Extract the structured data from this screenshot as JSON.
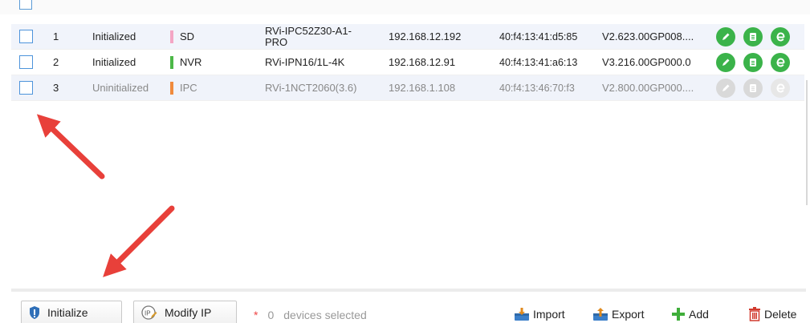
{
  "table": {
    "rows": [
      {
        "no": "1",
        "status": "Initialized",
        "type": "SD",
        "type_color": "#f4a6c4",
        "model_line1": "RVi-IPC52Z30-A1-",
        "model_line2": "PRO",
        "ip": "192.168.12.192",
        "mac": "40:f4:13:41:d5:85",
        "version": "V2.623.00GP008....",
        "enabled": true
      },
      {
        "no": "2",
        "status": "Initialized",
        "type": "NVR",
        "type_color": "#4cb848",
        "model_line1": "RVi-IPN16/1L-4K",
        "model_line2": "",
        "ip": "192.168.12.91",
        "mac": "40:f4:13:41:a6:13",
        "version": "V3.216.00GP000.0",
        "enabled": true
      },
      {
        "no": "3",
        "status": "Uninitialized",
        "type": "IPC",
        "type_color": "#f08a3c",
        "model_line1": "RVi-1NCT2060(3.6)",
        "model_line2": "",
        "ip": "192.168.1.108",
        "mac": "40:f4:13:46:70:f3",
        "version": "V2.800.00GP000....",
        "enabled": false
      }
    ],
    "op_icons": [
      "edit-icon",
      "details-icon",
      "web-icon"
    ],
    "op_colors": {
      "enabled": "#3bb34a",
      "disabled": "#d9d9d9"
    }
  },
  "toolbar": {
    "initialize_label": "Initialize",
    "modify_ip_label": "Modify IP",
    "selected_marker": "*",
    "selected_count": "0",
    "selected_text": "devices selected",
    "import_label": "Import",
    "export_label": "Export",
    "add_label": "Add",
    "delete_label": "Delete"
  },
  "colors": {
    "accent": "#4d94db",
    "arrow": "#e8403a"
  }
}
